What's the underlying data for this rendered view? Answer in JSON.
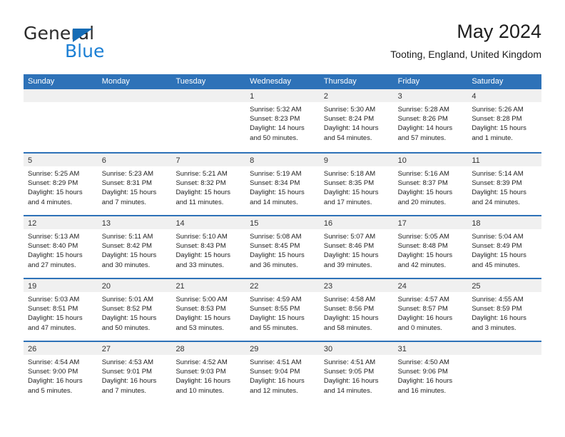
{
  "brand": {
    "name_top": "General",
    "name_bottom": "Blue",
    "triangle_color": "#166cb5",
    "blue_text_color": "#1b7fd4"
  },
  "header": {
    "title": "May 2024",
    "subtitle": "Tooting, England, United Kingdom"
  },
  "theme": {
    "header_bar_color": "#2e72b8",
    "day_strip_color": "#f0f0f0",
    "row_divider_color": "#2e72b8",
    "page_background": "#ffffff"
  },
  "weekday_headers": [
    "Sunday",
    "Monday",
    "Tuesday",
    "Wednesday",
    "Thursday",
    "Friday",
    "Saturday"
  ],
  "weeks": [
    [
      {
        "day": "",
        "lines": []
      },
      {
        "day": "",
        "lines": []
      },
      {
        "day": "",
        "lines": []
      },
      {
        "day": "1",
        "lines": [
          "Sunrise: 5:32 AM",
          "Sunset: 8:23 PM",
          "Daylight: 14 hours",
          "and 50 minutes."
        ]
      },
      {
        "day": "2",
        "lines": [
          "Sunrise: 5:30 AM",
          "Sunset: 8:24 PM",
          "Daylight: 14 hours",
          "and 54 minutes."
        ]
      },
      {
        "day": "3",
        "lines": [
          "Sunrise: 5:28 AM",
          "Sunset: 8:26 PM",
          "Daylight: 14 hours",
          "and 57 minutes."
        ]
      },
      {
        "day": "4",
        "lines": [
          "Sunrise: 5:26 AM",
          "Sunset: 8:28 PM",
          "Daylight: 15 hours",
          "and 1 minute."
        ]
      }
    ],
    [
      {
        "day": "5",
        "lines": [
          "Sunrise: 5:25 AM",
          "Sunset: 8:29 PM",
          "Daylight: 15 hours",
          "and 4 minutes."
        ]
      },
      {
        "day": "6",
        "lines": [
          "Sunrise: 5:23 AM",
          "Sunset: 8:31 PM",
          "Daylight: 15 hours",
          "and 7 minutes."
        ]
      },
      {
        "day": "7",
        "lines": [
          "Sunrise: 5:21 AM",
          "Sunset: 8:32 PM",
          "Daylight: 15 hours",
          "and 11 minutes."
        ]
      },
      {
        "day": "8",
        "lines": [
          "Sunrise: 5:19 AM",
          "Sunset: 8:34 PM",
          "Daylight: 15 hours",
          "and 14 minutes."
        ]
      },
      {
        "day": "9",
        "lines": [
          "Sunrise: 5:18 AM",
          "Sunset: 8:35 PM",
          "Daylight: 15 hours",
          "and 17 minutes."
        ]
      },
      {
        "day": "10",
        "lines": [
          "Sunrise: 5:16 AM",
          "Sunset: 8:37 PM",
          "Daylight: 15 hours",
          "and 20 minutes."
        ]
      },
      {
        "day": "11",
        "lines": [
          "Sunrise: 5:14 AM",
          "Sunset: 8:39 PM",
          "Daylight: 15 hours",
          "and 24 minutes."
        ]
      }
    ],
    [
      {
        "day": "12",
        "lines": [
          "Sunrise: 5:13 AM",
          "Sunset: 8:40 PM",
          "Daylight: 15 hours",
          "and 27 minutes."
        ]
      },
      {
        "day": "13",
        "lines": [
          "Sunrise: 5:11 AM",
          "Sunset: 8:42 PM",
          "Daylight: 15 hours",
          "and 30 minutes."
        ]
      },
      {
        "day": "14",
        "lines": [
          "Sunrise: 5:10 AM",
          "Sunset: 8:43 PM",
          "Daylight: 15 hours",
          "and 33 minutes."
        ]
      },
      {
        "day": "15",
        "lines": [
          "Sunrise: 5:08 AM",
          "Sunset: 8:45 PM",
          "Daylight: 15 hours",
          "and 36 minutes."
        ]
      },
      {
        "day": "16",
        "lines": [
          "Sunrise: 5:07 AM",
          "Sunset: 8:46 PM",
          "Daylight: 15 hours",
          "and 39 minutes."
        ]
      },
      {
        "day": "17",
        "lines": [
          "Sunrise: 5:05 AM",
          "Sunset: 8:48 PM",
          "Daylight: 15 hours",
          "and 42 minutes."
        ]
      },
      {
        "day": "18",
        "lines": [
          "Sunrise: 5:04 AM",
          "Sunset: 8:49 PM",
          "Daylight: 15 hours",
          "and 45 minutes."
        ]
      }
    ],
    [
      {
        "day": "19",
        "lines": [
          "Sunrise: 5:03 AM",
          "Sunset: 8:51 PM",
          "Daylight: 15 hours",
          "and 47 minutes."
        ]
      },
      {
        "day": "20",
        "lines": [
          "Sunrise: 5:01 AM",
          "Sunset: 8:52 PM",
          "Daylight: 15 hours",
          "and 50 minutes."
        ]
      },
      {
        "day": "21",
        "lines": [
          "Sunrise: 5:00 AM",
          "Sunset: 8:53 PM",
          "Daylight: 15 hours",
          "and 53 minutes."
        ]
      },
      {
        "day": "22",
        "lines": [
          "Sunrise: 4:59 AM",
          "Sunset: 8:55 PM",
          "Daylight: 15 hours",
          "and 55 minutes."
        ]
      },
      {
        "day": "23",
        "lines": [
          "Sunrise: 4:58 AM",
          "Sunset: 8:56 PM",
          "Daylight: 15 hours",
          "and 58 minutes."
        ]
      },
      {
        "day": "24",
        "lines": [
          "Sunrise: 4:57 AM",
          "Sunset: 8:57 PM",
          "Daylight: 16 hours",
          "and 0 minutes."
        ]
      },
      {
        "day": "25",
        "lines": [
          "Sunrise: 4:55 AM",
          "Sunset: 8:59 PM",
          "Daylight: 16 hours",
          "and 3 minutes."
        ]
      }
    ],
    [
      {
        "day": "26",
        "lines": [
          "Sunrise: 4:54 AM",
          "Sunset: 9:00 PM",
          "Daylight: 16 hours",
          "and 5 minutes."
        ]
      },
      {
        "day": "27",
        "lines": [
          "Sunrise: 4:53 AM",
          "Sunset: 9:01 PM",
          "Daylight: 16 hours",
          "and 7 minutes."
        ]
      },
      {
        "day": "28",
        "lines": [
          "Sunrise: 4:52 AM",
          "Sunset: 9:03 PM",
          "Daylight: 16 hours",
          "and 10 minutes."
        ]
      },
      {
        "day": "29",
        "lines": [
          "Sunrise: 4:51 AM",
          "Sunset: 9:04 PM",
          "Daylight: 16 hours",
          "and 12 minutes."
        ]
      },
      {
        "day": "30",
        "lines": [
          "Sunrise: 4:51 AM",
          "Sunset: 9:05 PM",
          "Daylight: 16 hours",
          "and 14 minutes."
        ]
      },
      {
        "day": "31",
        "lines": [
          "Sunrise: 4:50 AM",
          "Sunset: 9:06 PM",
          "Daylight: 16 hours",
          "and 16 minutes."
        ]
      },
      {
        "day": "",
        "lines": []
      }
    ]
  ]
}
